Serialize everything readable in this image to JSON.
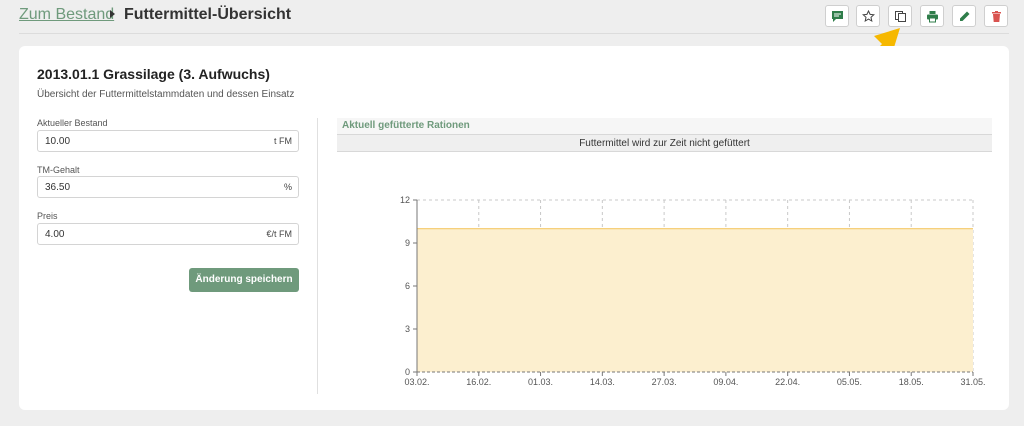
{
  "breadcrumb": {
    "back_link": "Zum Bestand",
    "current": "Futtermittel-Übersicht"
  },
  "toolbar": {
    "buttons": [
      {
        "icon": "comment-icon",
        "color": "#2f7d4a"
      },
      {
        "icon": "star-icon",
        "color": "#444444"
      },
      {
        "icon": "copy-icon",
        "color": "#444444"
      },
      {
        "icon": "print-icon",
        "color": "#2f7d4a"
      },
      {
        "icon": "pencil-icon",
        "color": "#2f7d4a"
      },
      {
        "icon": "trash-icon",
        "color": "#d9534f"
      }
    ],
    "hint_arrow_color": "#f6b800"
  },
  "feed": {
    "title": "2013.01.1 Grassilage (3. Aufwuchs)",
    "subtitle": "Übersicht der Futtermittelstammdaten und dessen Einsatz"
  },
  "form": {
    "fields": [
      {
        "label": "Aktueller Bestand",
        "value": "10.00",
        "unit": "t FM"
      },
      {
        "label": "TM-Gehalt",
        "value": "36.50",
        "unit": "%"
      },
      {
        "label": "Preis",
        "value": "4.00",
        "unit": "€/t FM"
      }
    ],
    "save_label": "Änderung speichern"
  },
  "rations": {
    "title": "Aktuell gefütterte Rationen",
    "message": "Futtermittel wird zur Zeit nicht gefüttert"
  },
  "colors": {
    "accent": "#6f9a7c",
    "area_fill": "#fcefcf",
    "area_line": "#f5c96a"
  },
  "chart_data": {
    "type": "area",
    "x": [
      "03.02.",
      "16.02.",
      "01.03.",
      "14.03.",
      "27.03.",
      "09.04.",
      "22.04.",
      "05.05.",
      "18.05.",
      "31.05."
    ],
    "series": [
      {
        "values": [
          10,
          10,
          10,
          10,
          10,
          10,
          10,
          10,
          10,
          10
        ]
      }
    ],
    "yticks": [
      0,
      3,
      6,
      9,
      12
    ],
    "ylim": [
      0,
      12
    ],
    "grid": true,
    "title": "",
    "xlabel": "",
    "ylabel": ""
  }
}
